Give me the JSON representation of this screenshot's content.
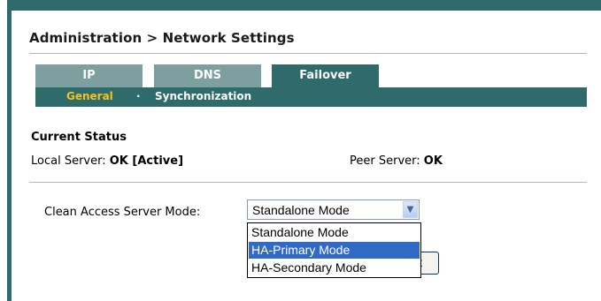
{
  "breadcrumb": {
    "title": "Administration > Network Settings"
  },
  "tabs": [
    {
      "label": "IP",
      "active": false
    },
    {
      "label": "DNS",
      "active": false
    },
    {
      "label": "Failover",
      "active": true
    }
  ],
  "subnav": {
    "active": "General",
    "separator": "·",
    "other": "Synchronization"
  },
  "status": {
    "heading": "Current Status",
    "local_label": "Local Server:",
    "local_value": "OK [Active]",
    "peer_label": "Peer Server:",
    "peer_value": "OK"
  },
  "mode": {
    "label": "Clean Access Server Mode:",
    "selected": "Standalone Mode",
    "options": [
      "Standalone Mode",
      "HA-Primary Mode",
      "HA-Secondary Mode"
    ],
    "highlighted_index": 1
  },
  "button": {
    "visible_label": "t"
  },
  "colors": {
    "teal": "#2f6b6b",
    "teal_light": "#7d9f9f",
    "accent": "#f6c21c",
    "highlight": "#316ac5"
  }
}
